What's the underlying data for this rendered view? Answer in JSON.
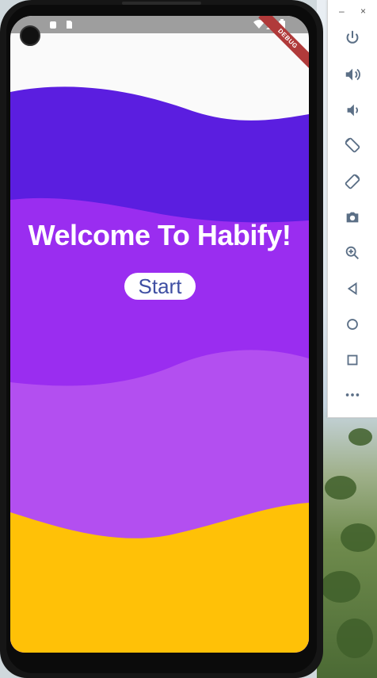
{
  "app": {
    "welcome_text": "Welcome To Habify!",
    "start_label": "Start",
    "debug_badge": "DEBUG"
  },
  "emulator_toolbar": {
    "minimize_label": "–",
    "close_label": "×",
    "buttons": [
      {
        "name": "power-icon"
      },
      {
        "name": "volume-up-icon"
      },
      {
        "name": "volume-down-icon"
      },
      {
        "name": "rotate-left-icon"
      },
      {
        "name": "rotate-right-icon"
      },
      {
        "name": "camera-icon"
      },
      {
        "name": "zoom-icon"
      },
      {
        "name": "back-icon"
      },
      {
        "name": "home-icon"
      },
      {
        "name": "overview-icon"
      },
      {
        "name": "more-icon"
      }
    ]
  },
  "colors": {
    "wave_top": "#5b1ee0",
    "wave_mid": "#9a2df0",
    "wave_low": "#b34ff0",
    "wave_bottom": "#ffc107",
    "background": "#fafafa",
    "button_text": "#3f4fa3"
  }
}
